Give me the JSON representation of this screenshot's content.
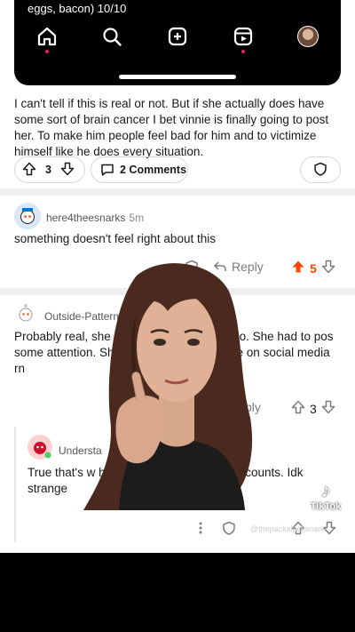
{
  "phone": {
    "caption": "eggs, bacon) 10/10"
  },
  "post_comment": {
    "text": "I can't tell if this is real or not. But if she actually does have some sort of brain cancer I bet vinnie is finally going to post her. To make him people feel bad for him and to victimize himself like he does every situation.",
    "vote_count": "3",
    "comments_label": "2 Comments"
  },
  "comment1": {
    "username": "here4theesnarks",
    "time": "5m",
    "text": "something doesn't feel right about this",
    "reply_label": "Reply",
    "vote_count": "5"
  },
  "comment2": {
    "username": "Outside-Pattern",
    "text": "Probably real, she s                                  e had a terrible day too. She had to pos                                 some attention. She'll be fine, if it w                                     ldn't be on social media rn",
    "reply_label": "ply",
    "vote_count": "3"
  },
  "comment3": {
    "username": "Understa",
    "text": "True that's w                                   h her breakfast sandwich a                                  counts. Idk strange"
  },
  "overlay": {
    "tiktok_label": "TikTok",
    "watermark": "@thepackalacksnark"
  },
  "colors": {
    "upvote_active": "#ff4500",
    "background": "#ffffff",
    "divider": "#eeeeef"
  }
}
